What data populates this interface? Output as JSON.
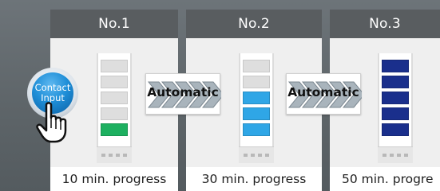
{
  "contact_button": {
    "label_line1": "Contact",
    "label_line2": "Input"
  },
  "steps": [
    {
      "title": "No.1",
      "caption": "10 min. progress",
      "segments": [
        "#dedede",
        "#dedede",
        "#dedede",
        "#dedede",
        "#1db060"
      ]
    },
    {
      "title": "No.2",
      "caption": "30 min. progress",
      "segments": [
        "#dedede",
        "#dedede",
        "#2fa6e6",
        "#2fa6e6",
        "#2fa6e6"
      ]
    },
    {
      "title": "No.3",
      "caption": "50 min. progre",
      "segments": [
        "#1a2f8c",
        "#1a2f8c",
        "#1a2f8c",
        "#1a2f8c",
        "#1a2f8c"
      ]
    }
  ],
  "transitions": [
    {
      "label": "Automatic"
    },
    {
      "label": "Automatic"
    }
  ],
  "colors": {
    "background": "#5f666b",
    "panel_header": "#595d60",
    "arrow_fill": "#a9b4bc",
    "arrow_stroke": "#7c8891"
  },
  "icons": [
    "hand-pointer-icon",
    "chevron-arrows-icon"
  ]
}
